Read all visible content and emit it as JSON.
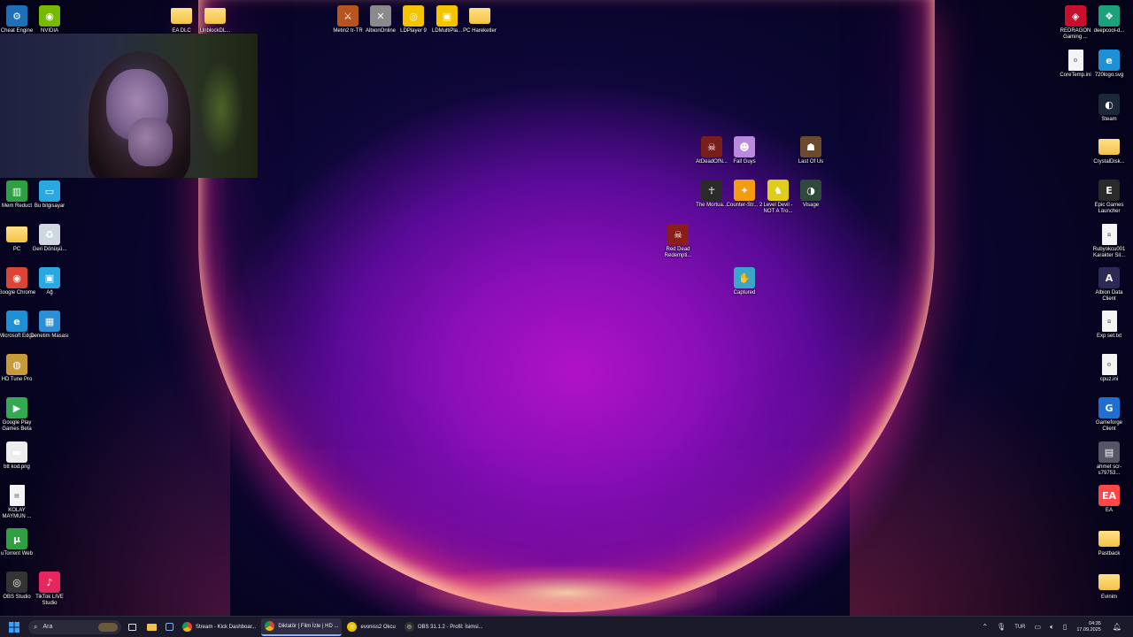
{
  "colors": {
    "taskbar_bg": "#1b1a2a",
    "folder": "#f3c244",
    "wallpaper_center": "#b012c8",
    "ring_edge": "#ff3c78"
  },
  "desktop": {
    "icons": [
      {
        "id": "cheat-engine",
        "label": "Cheat Engine",
        "icon": "cheat-engine-icon",
        "glyph": "⚙",
        "color": "#1d6fb8"
      },
      {
        "id": "nvidia",
        "label": "NVIDIA",
        "icon": "nvidia-icon",
        "glyph": "◉",
        "color": "#76b900"
      },
      {
        "id": "ea-dlc",
        "label": "EA DLC",
        "icon": "folder-icon",
        "glyph": "",
        "color": "#f3c244"
      },
      {
        "id": "unblockdl",
        "label": "UnblockDL...",
        "icon": "folder-icon",
        "glyph": "",
        "color": "#f3c244"
      },
      {
        "id": "metin2",
        "label": "Metin2 tr-TR",
        "icon": "metin2-icon",
        "glyph": "⚔",
        "color": "#b8541d"
      },
      {
        "id": "albion",
        "label": "AlbionOnline",
        "icon": "albion-icon",
        "glyph": "✕",
        "color": "#8a8a8a"
      },
      {
        "id": "ldplayer9",
        "label": "LDPlayer 9",
        "icon": "ldplayer-icon",
        "glyph": "◎",
        "color": "#f5c400"
      },
      {
        "id": "ldmultiplayer",
        "label": "LDMultiPla...",
        "icon": "ldmulti-icon",
        "glyph": "▣",
        "color": "#f5c400"
      },
      {
        "id": "pc-hareketler",
        "label": "PC Hareketler",
        "icon": "folder-icon",
        "glyph": "",
        "color": "#f3c244"
      },
      {
        "id": "redragon",
        "label": "REDRAGON Gaming ...",
        "icon": "redragon-icon",
        "glyph": "◈",
        "color": "#c8102e"
      },
      {
        "id": "deepcool",
        "label": "deepcool-d...",
        "icon": "deepcool-icon",
        "glyph": "❖",
        "color": "#1aa37a"
      },
      {
        "id": "coretemp",
        "label": "CoreTemp.ini",
        "icon": "ini-file-icon",
        "glyph": "⚙",
        "color": "#eeeeee"
      },
      {
        "id": "720logo",
        "label": "720logo.svg",
        "icon": "edge-icon",
        "glyph": "e",
        "color": "#1e90d6"
      },
      {
        "id": "steam",
        "label": "Steam",
        "icon": "steam-icon",
        "glyph": "◐",
        "color": "#1b2838"
      },
      {
        "id": "crystaldisk",
        "label": "CrystalDisk...",
        "icon": "folder-icon",
        "glyph": "",
        "color": "#f3c244"
      },
      {
        "id": "epic",
        "label": "Epic Games Launcher",
        "icon": "epic-games-icon",
        "glyph": "E",
        "color": "#2a2a2a"
      },
      {
        "id": "rubyokcu",
        "label": "Rubyokcu001 Karakter Sil...",
        "icon": "text-file-icon",
        "glyph": "≡",
        "color": "#eeeeee"
      },
      {
        "id": "albion-data",
        "label": "Albion Data Client",
        "icon": "albion-data-icon",
        "glyph": "A",
        "color": "#2a2a55"
      },
      {
        "id": "expset",
        "label": "Exp set.txt",
        "icon": "text-file-icon",
        "glyph": "≡",
        "color": "#eeeeee"
      },
      {
        "id": "cpuz",
        "label": "cpuz.ini",
        "icon": "ini-file-icon",
        "glyph": "⚙",
        "color": "#eeeeee"
      },
      {
        "id": "gameforge",
        "label": "Gameforge Client",
        "icon": "gameforge-icon",
        "glyph": "G",
        "color": "#1f6fd1"
      },
      {
        "id": "ahmet",
        "label": "ahmet scr-s79753...",
        "icon": "image-file-icon",
        "glyph": "▤",
        "color": "#555566"
      },
      {
        "id": "ea",
        "label": "EA",
        "icon": "ea-icon",
        "glyph": "EA",
        "color": "#ff4747"
      },
      {
        "id": "pastback",
        "label": "Pastback",
        "icon": "folder-icon",
        "glyph": "",
        "color": "#f3c244"
      },
      {
        "id": "evinim",
        "label": "Evinim",
        "icon": "folder-icon",
        "glyph": "",
        "color": "#f3c244"
      },
      {
        "id": "mem-reduct",
        "label": "Mem Reduct",
        "icon": "mem-reduct-icon",
        "glyph": "▥",
        "color": "#2ea043"
      },
      {
        "id": "bu-bilgisayar",
        "label": "Bu bilgisayar",
        "icon": "computer-icon",
        "glyph": "▭",
        "color": "#2aa8e0"
      },
      {
        "id": "pc",
        "label": "PC",
        "icon": "folder-icon",
        "glyph": "",
        "color": "#f3c244"
      },
      {
        "id": "geri-donusum",
        "label": "Geri Dönüşü...",
        "icon": "recycle-bin-icon",
        "glyph": "♻",
        "color": "#cfd8e0"
      },
      {
        "id": "google-chrome",
        "label": "Google Chrome",
        "icon": "chrome-icon",
        "glyph": "◉",
        "color": "#db4437"
      },
      {
        "id": "ag",
        "label": "Ağ",
        "icon": "network-icon",
        "glyph": "▣",
        "color": "#2aa8e0"
      },
      {
        "id": "ms-edge",
        "label": "Microsoft Edge",
        "icon": "edge-icon",
        "glyph": "e",
        "color": "#1e90d6"
      },
      {
        "id": "denetim-masasi",
        "label": "Denetim Masası",
        "icon": "control-panel-icon",
        "glyph": "▦",
        "color": "#2a8fd6"
      },
      {
        "id": "hd-tune",
        "label": "HD Tune Pro",
        "icon": "hdtune-icon",
        "glyph": "◍",
        "color": "#c79a3a"
      },
      {
        "id": "gplay-games",
        "label": "Google Play Games Beta",
        "icon": "google-play-games-icon",
        "glyph": "▶",
        "color": "#34a853"
      },
      {
        "id": "btt-kod",
        "label": "btt kod.png",
        "icon": "image-file-icon",
        "glyph": "▬",
        "color": "#eeeeee"
      },
      {
        "id": "kolay-maymun",
        "label": "KOLAY MAYMUN ...",
        "icon": "document-icon",
        "glyph": "▤",
        "color": "#eeeeee"
      },
      {
        "id": "utorrent",
        "label": "uTorrent Web",
        "icon": "utorrent-icon",
        "glyph": "µ",
        "color": "#2ea043"
      },
      {
        "id": "obs",
        "label": "OBS Studio",
        "icon": "obs-icon",
        "glyph": "◎",
        "color": "#333333"
      },
      {
        "id": "tiktok-live",
        "label": "TikTok LIVE Studio",
        "icon": "tiktok-icon",
        "glyph": "♪",
        "color": "#e6265f"
      },
      {
        "id": "atdeadofn",
        "label": "AtDeadOfN...",
        "icon": "game-icon",
        "glyph": "☠",
        "color": "#7a1d1d"
      },
      {
        "id": "fall-guys",
        "label": "Fall Guys",
        "icon": "fall-guys-icon",
        "glyph": "☻",
        "color": "#b98ae0"
      },
      {
        "id": "last-of-us",
        "label": "Last Of Us",
        "icon": "game-icon",
        "glyph": "☗",
        "color": "#6b4a2e"
      },
      {
        "id": "the-mortua",
        "label": "The Mortua...",
        "icon": "game-icon",
        "glyph": "☥",
        "color": "#2a2a2a"
      },
      {
        "id": "counter-strike",
        "label": "Counter-Str... 2",
        "icon": "cs2-icon",
        "glyph": "✦",
        "color": "#f39c12"
      },
      {
        "id": "level-devil",
        "label": "Level Devil - NOT A Tro...",
        "icon": "game-icon",
        "glyph": "♞",
        "color": "#e0cc1a"
      },
      {
        "id": "visage",
        "label": "Visage",
        "icon": "game-icon",
        "glyph": "◑",
        "color": "#2f4a3a"
      },
      {
        "id": "red-dead",
        "label": "Red Dead Redempti...",
        "icon": "game-icon",
        "glyph": "☠",
        "color": "#8a1c1c"
      },
      {
        "id": "captured",
        "label": "Captured",
        "icon": "game-icon",
        "glyph": "✋",
        "color": "#3aa7c8"
      }
    ]
  },
  "taskbar": {
    "search_placeholder": "Ara",
    "apps": [
      {
        "id": "chrome-stream",
        "label": "Stream - Kick Dashboar...",
        "icon": "chrome-icon",
        "active": false
      },
      {
        "id": "chrome-diktator",
        "label": "Diktatör | Film İzle | HD ...",
        "icon": "chrome-icon",
        "active": true
      },
      {
        "id": "evoniss",
        "label": "evoniss2 Okcu",
        "icon": "metin2-icon",
        "active": false
      },
      {
        "id": "obs-app",
        "label": "OBS 31.1.2 - Profil: İsimsi...",
        "icon": "obs-icon",
        "active": false
      }
    ],
    "tray": {
      "language": "TUR",
      "time": "04:35",
      "date": "17.09.2025"
    }
  }
}
